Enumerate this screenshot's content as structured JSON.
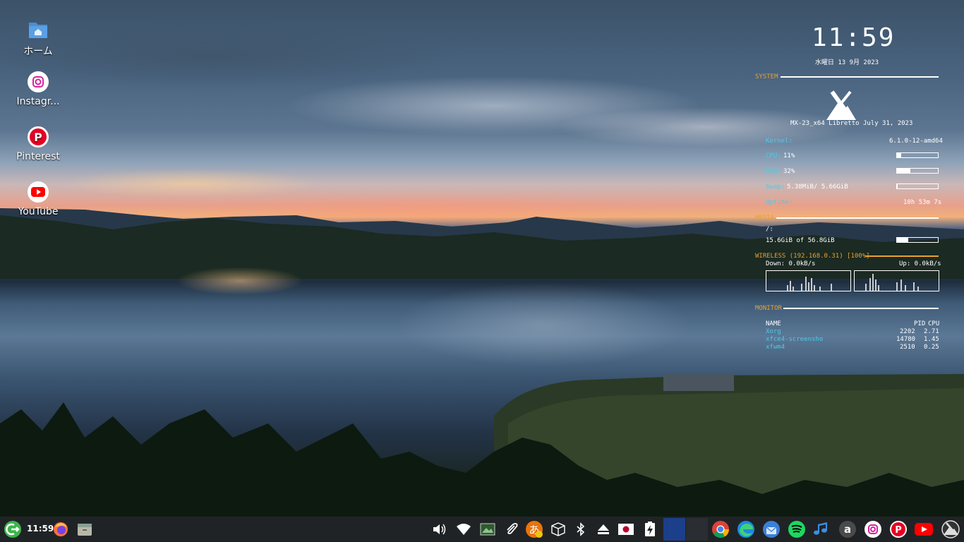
{
  "desktop": {
    "icons": [
      {
        "label": "ホーム",
        "icon": "home-folder-icon"
      },
      {
        "label": "Instagr...",
        "icon": "instagram-icon"
      },
      {
        "label": "Pinterest",
        "icon": "pinterest-icon"
      },
      {
        "label": "YouTube",
        "icon": "youtube-icon"
      }
    ]
  },
  "conky": {
    "time": "11:59",
    "date": "水曜日 13 9月 2023",
    "system": {
      "header": "SYSTEM",
      "distro": "MX-23_x64 Libretto July 31, 2023",
      "kernel_label": "Kernel:",
      "kernel_value": "6.1.0-12-amd64",
      "cpu_label": "CPU:",
      "cpu_value": "11%",
      "cpu_fraction": 0.11,
      "ram_label": "RAM:",
      "ram_value": "32%",
      "ram_fraction": 0.32,
      "swap_label": "Swap:",
      "swap_value": "5.38MiB/ 5.66GiB",
      "swap_fraction": 0.0,
      "uptime_label": "Uptime:",
      "uptime_value": "10h 53m 7s"
    },
    "media": {
      "header": "MEDIA",
      "mount": "/:",
      "usage": "15.6GiB of 56.8GiB",
      "fraction": 0.27
    },
    "wireless": {
      "header": "WIRELESS (192.168.0.31) [100%]",
      "down": "Down: 0.0kB/s",
      "up": "Up: 0.0kB/s"
    },
    "monitor": {
      "header": "MONITOR",
      "col_name": "NAME",
      "col_pid": "PID",
      "col_cpu": "CPU",
      "rows": [
        {
          "name": "Xorg",
          "pid": "2202",
          "cpu": "2.71"
        },
        {
          "name": "xfce4-screensho",
          "pid": "14780",
          "cpu": "1.45"
        },
        {
          "name": "xfwm4",
          "pid": "2510",
          "cpu": "0.25"
        }
      ]
    }
  },
  "taskbar": {
    "clock": "11:59",
    "launchers": [
      "logout-icon",
      "firefox-icon",
      "file-manager-icon"
    ],
    "tray": [
      "volume-icon",
      "wifi-icon",
      "screenshot-icon",
      "clip-icon",
      "input-method-icon",
      "package-icon",
      "bluetooth-icon",
      "eject-icon",
      "japan-flag-icon",
      "battery-charging-icon"
    ],
    "apps": [
      "chrome-icon",
      "edge-icon",
      "thunderbird-icon",
      "spotify-icon",
      "music-icon",
      "amazon-icon",
      "instagram-icon",
      "pinterest-icon",
      "youtube-icon",
      "mx-logo-icon"
    ],
    "workspace_color": "#1c3f8c"
  }
}
